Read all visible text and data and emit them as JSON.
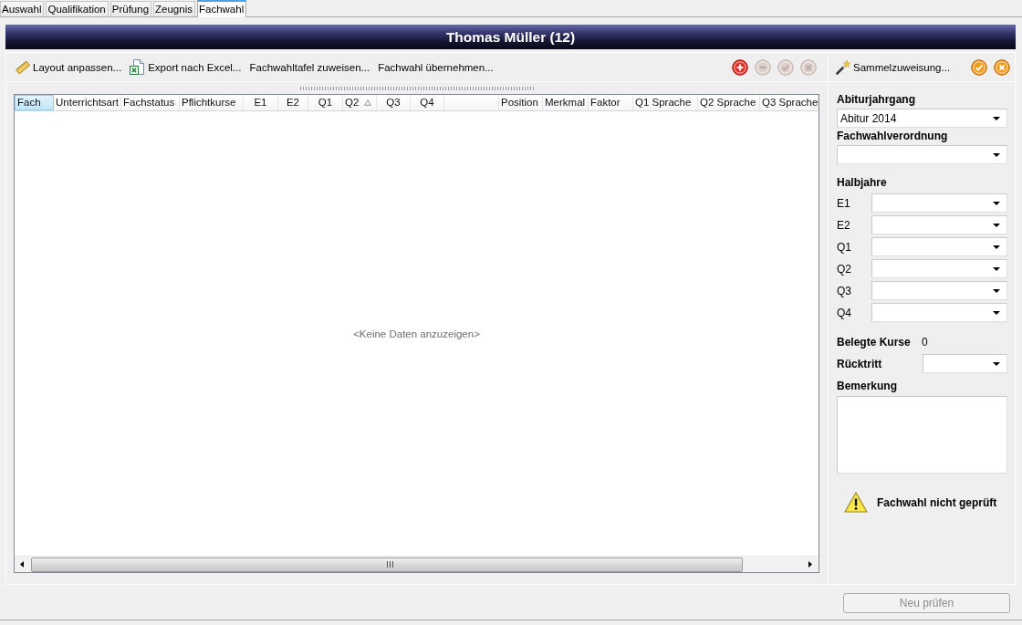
{
  "tabs": [
    {
      "label": "Auswahl",
      "selected": false
    },
    {
      "label": "Qualifikation",
      "selected": false
    },
    {
      "label": "Prüfung",
      "selected": false
    },
    {
      "label": "Zeugnis",
      "selected": false
    },
    {
      "label": "Fachwahl",
      "selected": true
    }
  ],
  "header": {
    "title": "Thomas Müller (12)"
  },
  "toolbar": {
    "actions": [
      {
        "label": "Layout anpassen..."
      },
      {
        "label": "Export nach Excel..."
      },
      {
        "label": "Fachwahltafel zuweisen..."
      },
      {
        "label": "Fachwahl übernehmen..."
      }
    ],
    "record_buttons": [
      {
        "kind": "add",
        "disabled": false
      },
      {
        "kind": "remove",
        "disabled": true
      },
      {
        "kind": "accept",
        "disabled": true
      },
      {
        "kind": "cancel",
        "disabled": true
      }
    ]
  },
  "table": {
    "columns": [
      {
        "label": "Fach",
        "selected": true,
        "sorted": false
      },
      {
        "label": "Unterrichtsart",
        "selected": false,
        "sorted": false
      },
      {
        "label": "Fachstatus",
        "selected": false,
        "sorted": false
      },
      {
        "label": "Pflichtkurse",
        "selected": false,
        "sorted": false
      },
      {
        "label": "E1",
        "selected": false,
        "sorted": false
      },
      {
        "label": "E2",
        "selected": false,
        "sorted": false
      },
      {
        "label": "Q1",
        "selected": false,
        "sorted": false
      },
      {
        "label": "Q2",
        "selected": false,
        "sorted": true
      },
      {
        "label": "Q3",
        "selected": false,
        "sorted": false
      },
      {
        "label": "Q4",
        "selected": false,
        "sorted": false
      },
      {
        "selected": false,
        "sorted": false
      },
      {
        "label": "Position",
        "selected": false,
        "sorted": false
      },
      {
        "label": "Merkmal",
        "selected": false,
        "sorted": false
      },
      {
        "label": "Faktor",
        "selected": false,
        "sorted": false
      },
      {
        "label": "Q1 Sprache",
        "selected": false,
        "sorted": false
      },
      {
        "label": "Q2 Sprache",
        "selected": false,
        "sorted": false
      },
      {
        "label": "Q3 Sprache",
        "selected": false,
        "sorted": false
      }
    ],
    "empty_text": "<Keine Daten anzuzeigen>"
  },
  "side_panel": {
    "toolbar": {
      "label": "Sammelzuweisung...",
      "buttons": [
        {
          "kind": "accept",
          "disabled": false
        },
        {
          "kind": "cancel",
          "disabled": false
        }
      ]
    },
    "abiturjahrgang": {
      "label": "Abiturjahrgang",
      "value": "Abitur 2014"
    },
    "fachwahlverordnung": {
      "label": "Fachwahlverordnung"
    },
    "halbjahre": {
      "label": "Halbjahre",
      "rows": [
        {
          "label": "E1"
        },
        {
          "label": "E2"
        },
        {
          "label": "Q1"
        },
        {
          "label": "Q2"
        },
        {
          "label": "Q3"
        },
        {
          "label": "Q4"
        }
      ]
    },
    "belegte_kurse": {
      "label": "Belegte Kurse",
      "value": "0"
    },
    "ruecktritt": {
      "label": "Rücktritt"
    },
    "bemerkung": {
      "label": "Bemerkung"
    },
    "status": {
      "kind": "warning",
      "text": "Fachwahl nicht geprüft"
    }
  },
  "footer": {
    "recheck_button": {
      "label": "Neu prüfen",
      "disabled": true
    }
  }
}
